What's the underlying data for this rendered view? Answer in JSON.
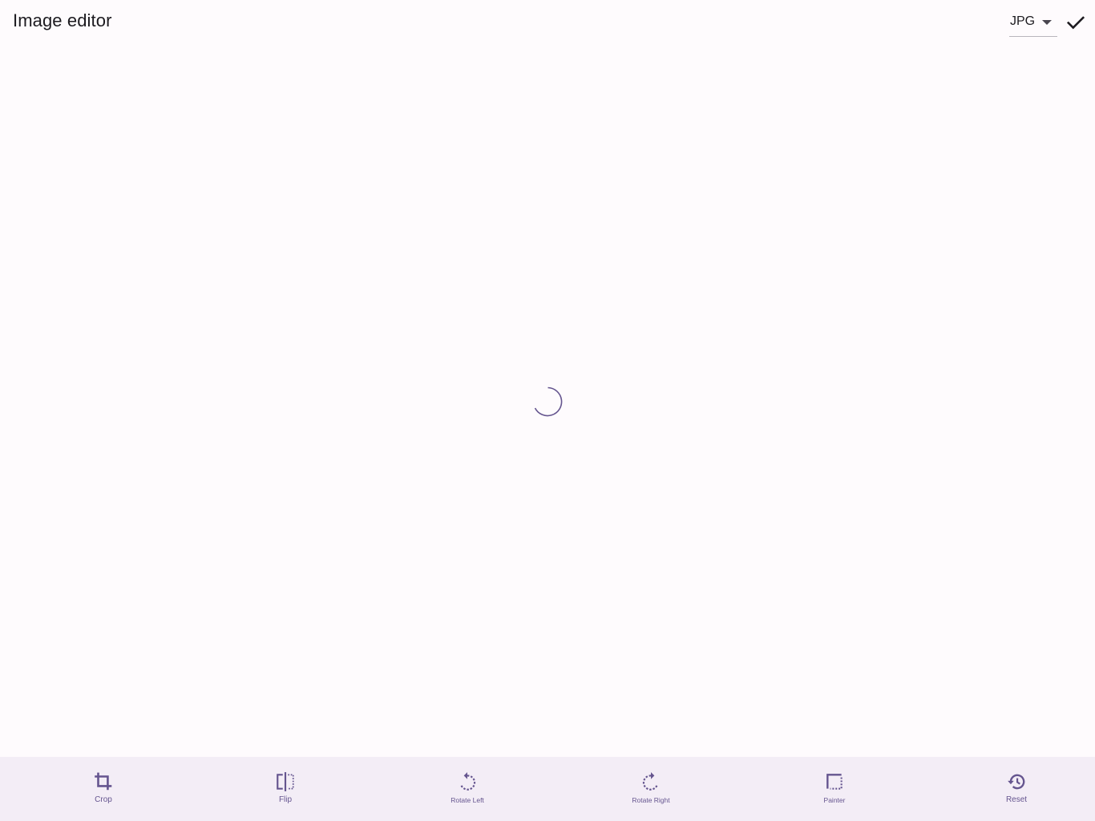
{
  "header": {
    "title": "Image editor",
    "format_select": {
      "value": "JPG",
      "icon": "arrow-drop-down-icon"
    },
    "confirm_icon": "check-icon"
  },
  "canvas": {
    "state": "loading",
    "spinner_icon": "loading-spinner-icon"
  },
  "toolbar": {
    "items": [
      {
        "label": "Crop",
        "icon": "crop-icon"
      },
      {
        "label": "Flip",
        "icon": "flip-icon"
      },
      {
        "label": "Rotate Left",
        "icon": "rotate-left-icon"
      },
      {
        "label": "Rotate Right",
        "icon": "rotate-right-icon"
      },
      {
        "label": "Painter",
        "icon": "painter-icon"
      },
      {
        "label": "Reset",
        "icon": "history-icon"
      }
    ]
  },
  "colors": {
    "background": "#fefbfd",
    "toolbar_background": "#f3edf6",
    "accent": "#65558f",
    "text": "#1d1b20"
  }
}
